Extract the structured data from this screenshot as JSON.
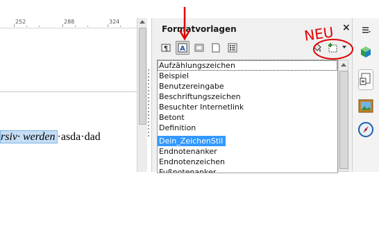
{
  "ruler": {
    "marks": [
      "252",
      "288",
      "324"
    ]
  },
  "document": {
    "selected_text": "rsiv· werden",
    "rest_text": "·asda·dad"
  },
  "styles_panel": {
    "title": "Formatvorlagen",
    "close_symbol": "×",
    "toolbar_buttons": [
      "paragraph-styles",
      "character-styles",
      "frame-styles",
      "page-styles",
      "list-styles",
      "fill-format-mode",
      "new-style-from-selection"
    ],
    "items": [
      "Aufzählungszeichen",
      "Beispiel",
      "Benutzereingabe",
      "Beschriftungszeichen",
      "Besuchter Internetlink",
      "Betont",
      "Definition",
      "Dein_ZeichenStil",
      "Endnotenanker",
      "Endnotenzeichen",
      "Fußnotenanker"
    ],
    "selected_item": "Dein_ZeichenStil"
  },
  "annotations": {
    "handwritten_label": "NEU",
    "color": "#e00000"
  },
  "sidebar": {
    "icons": [
      "menu-icon",
      "gallery-cube-icon",
      "styles-icon",
      "picture-frame-icon",
      "navigator-compass-icon"
    ]
  },
  "colors": {
    "selection": "#3399ff",
    "text_selection": "#c5def5",
    "annotation": "#e00000"
  }
}
